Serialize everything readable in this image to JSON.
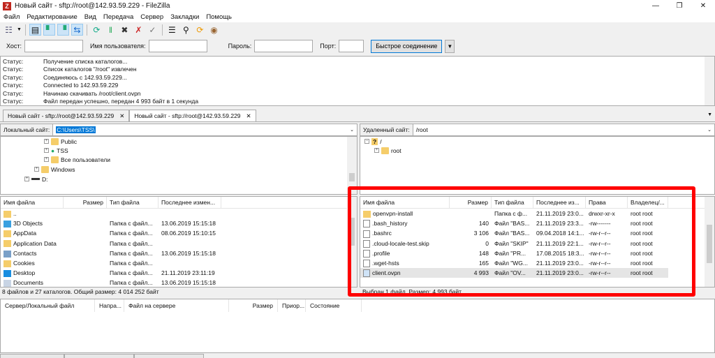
{
  "window": {
    "title": "Новый сайт - sftp://root@142.93.59.229 - FileZilla",
    "app_icon": "filezilla-icon"
  },
  "menu": [
    "Файл",
    "Редактирование",
    "Вид",
    "Передача",
    "Сервер",
    "Закладки",
    "Помощь"
  ],
  "quickconnect": {
    "host_label": "Хост:",
    "user_label": "Имя пользователя:",
    "pass_label": "Пароль:",
    "port_label": "Порт:",
    "host": "",
    "user": "",
    "pass": "",
    "port": "",
    "button": "Быстрое соединение"
  },
  "log": [
    {
      "k": "Статус:",
      "v": "Получение списка каталогов..."
    },
    {
      "k": "Статус:",
      "v": "Список каталогов \"/root\" извлечен"
    },
    {
      "k": "Статус:",
      "v": "Соединяюсь с 142.93.59.229..."
    },
    {
      "k": "Статус:",
      "v": "Connected to 142.93.59.229"
    },
    {
      "k": "Статус:",
      "v": "Начинаю скачивать /root/client.ovpn"
    },
    {
      "k": "Статус:",
      "v": "Файл передан успешно, передан 4 993 байт в 1 секунда"
    }
  ],
  "tabs": [
    "Новый сайт - sftp://root@142.93.59.229",
    "Новый сайт - sftp://root@142.93.59.229"
  ],
  "local": {
    "label": "Локальный сайт:",
    "path": "C:\\Users\\TSS\\",
    "tree": [
      "Public",
      "TSS",
      "Все пользователи",
      "Windows",
      "D:"
    ],
    "columns": [
      "Имя файла",
      "Размер",
      "Тип файла",
      "Последнее измен..."
    ],
    "rows": [
      {
        "name": "..",
        "size": "",
        "type": "",
        "date": ""
      },
      {
        "name": "3D Objects",
        "size": "",
        "type": "Папка с файл...",
        "date": "13.06.2019 15:15:18"
      },
      {
        "name": "AppData",
        "size": "",
        "type": "Папка с файл...",
        "date": "08.06.2019 15:10:15"
      },
      {
        "name": "Application Data",
        "size": "",
        "type": "Папка с файл...",
        "date": ""
      },
      {
        "name": "Contacts",
        "size": "",
        "type": "Папка с файл...",
        "date": "13.06.2019 15:15:18"
      },
      {
        "name": "Cookies",
        "size": "",
        "type": "Папка с файл...",
        "date": ""
      },
      {
        "name": "Desktop",
        "size": "",
        "type": "Папка с файл...",
        "date": "21.11.2019 23:11:19"
      },
      {
        "name": "Documents",
        "size": "",
        "type": "Папка с файл...",
        "date": "13.06.2019 15:15:18"
      }
    ],
    "status": "8 файлов и 27 каталогов. Общий размер: 4 014 252 байт"
  },
  "remote": {
    "label": "Удаленный сайт:",
    "path": "/root",
    "tree": [
      "/",
      "root"
    ],
    "columns": [
      "Имя файла",
      "Размер",
      "Тип файла",
      "Последнее из...",
      "Права",
      "Владелец/..."
    ],
    "rows": [
      {
        "name": "openvpn-install",
        "size": "",
        "type": "Папка с ф...",
        "date": "21.11.2019 23:0...",
        "perm": "drwxr-xr-x",
        "owner": "root root"
      },
      {
        "name": ".bash_history",
        "size": "140",
        "type": "Файл \"BAS...",
        "date": "21.11.2019 23:3...",
        "perm": "-rw-------",
        "owner": "root root"
      },
      {
        "name": ".bashrc",
        "size": "3 106",
        "type": "Файл \"BAS...",
        "date": "09.04.2018 14:1...",
        "perm": "-rw-r--r--",
        "owner": "root root"
      },
      {
        "name": ".cloud-locale-test.skip",
        "size": "0",
        "type": "Файл \"SKIP\"",
        "date": "21.11.2019 22:1...",
        "perm": "-rw-r--r--",
        "owner": "root root"
      },
      {
        "name": ".profile",
        "size": "148",
        "type": "Файл \"PR...",
        "date": "17.08.2015 18:3...",
        "perm": "-rw-r--r--",
        "owner": "root root"
      },
      {
        "name": ".wget-hsts",
        "size": "165",
        "type": "Файл \"WG...",
        "date": "21.11.2019 23:0...",
        "perm": "-rw-r--r--",
        "owner": "root root"
      },
      {
        "name": "client.ovpn",
        "size": "4 993",
        "type": "Файл \"OV...",
        "date": "21.11.2019 23:0...",
        "perm": "-rw-r--r--",
        "owner": "root root"
      }
    ],
    "selected_row": "client.ovpn",
    "status": "Выбран 1 файл. Размер: 4 993 байт"
  },
  "queue": {
    "columns": [
      "Сервер/Локальный файл",
      "Напра...",
      "Файл на сервере",
      "Размер",
      "Приор...",
      "Состояние"
    ]
  },
  "highlight_color": "#ff0000"
}
